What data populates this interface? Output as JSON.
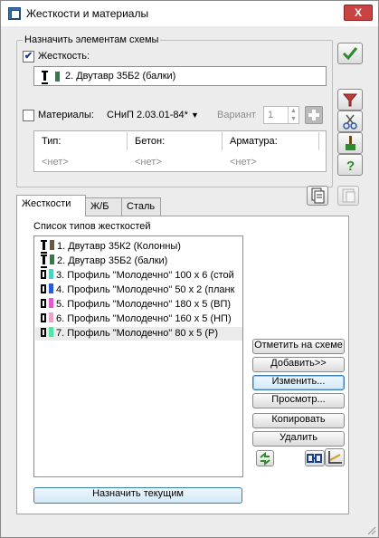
{
  "window": {
    "title": "Жесткости и материалы",
    "close_glyph": "X"
  },
  "assign": {
    "legend": "Назначить элементам схемы",
    "stiffness_checked": true,
    "stiffness_label": "Жесткость:",
    "stiffness_value": "2. Двутавр 35Б2 (балки)",
    "stiffness_color": "#2e7d46",
    "materials_checked": false,
    "materials_label": "Материалы:",
    "code_value": "СНиП 2.03.01-84*",
    "variant_label": "Вариант",
    "variant_value": "1",
    "columns": [
      "Тип:",
      "Бетон:",
      "Арматура:"
    ],
    "cells": [
      "<нет>",
      "<нет>",
      "<нет>"
    ]
  },
  "tabs": [
    "Жесткости",
    "Ж/Б",
    "Сталь"
  ],
  "active_tab": "Жесткости",
  "list": {
    "caption": "Список типов жесткостей",
    "items": [
      {
        "label": "1. Двутавр 35К2 (Колонны)",
        "icon": "i-beam",
        "color": "#6b5a3a"
      },
      {
        "label": "2. Двутавр 35Б2 (балки)",
        "icon": "i-beam",
        "color": "#2e7d46"
      },
      {
        "label": "3. Профиль \"Молодечно\" 100 x 6 (стой",
        "icon": "rect-tube",
        "color": "#4fd1c1"
      },
      {
        "label": "4. Профиль \"Молодечно\" 50 x 2 (планк",
        "icon": "rect-tube",
        "color": "#2a5bd8"
      },
      {
        "label": "5. Профиль \"Молодечно\" 180 x 5 (ВП)",
        "icon": "rect-tube",
        "color": "#e35ad4"
      },
      {
        "label": "6. Профиль \"Молодечно\" 160 x 5 (НП)",
        "icon": "rect-tube",
        "color": "#e9a3c4"
      },
      {
        "label": "7. Профиль \"Молодечно\" 80 x 5 (Р)",
        "icon": "rect-tube",
        "color": "#4ee6a6"
      }
    ],
    "selected_index": 6
  },
  "actions": {
    "mark": "Отметить на схеме",
    "add": "Добавить>>",
    "edit": "Изменить...",
    "view": "Просмотр...",
    "copy": "Копировать",
    "delete": "Удалить",
    "assign_current": "Назначить текущим"
  },
  "icons": {
    "ok": "check-icon",
    "filter": "filter-icon",
    "cut": "scissors-icon",
    "brush": "brush-icon",
    "help": "help-icon",
    "copy_doc": "document-copy-icon",
    "paste_doc": "document-paste-icon",
    "refresh": "refresh-arrows-icon",
    "section": "section-icon",
    "axes": "axes-icon"
  }
}
